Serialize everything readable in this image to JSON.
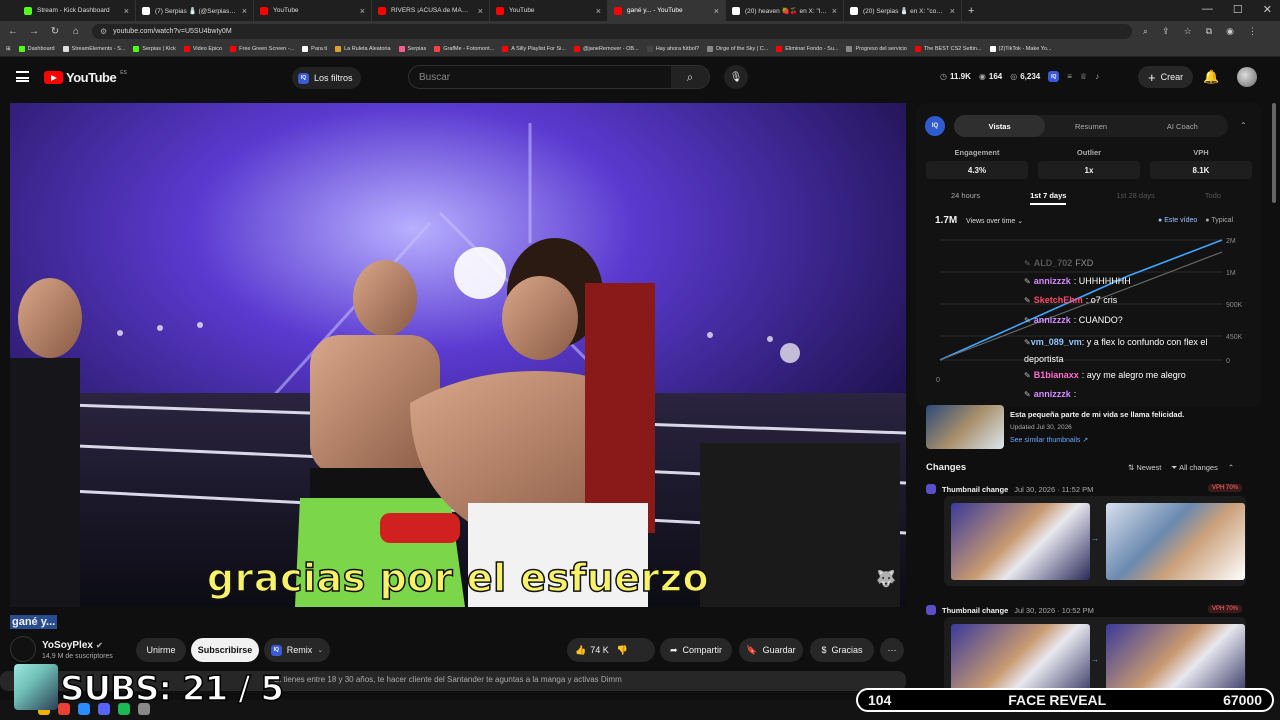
{
  "browser": {
    "tabs": [
      {
        "title": "Stream - Kick Dashboard",
        "color": "#53fc18",
        "active": false
      },
      {
        "title": "(7) Serpias 🧂 (@Serpias) / X",
        "color": "#ffffff",
        "active": false
      },
      {
        "title": "YouTube",
        "color": "#ff0000",
        "active": false
      },
      {
        "title": "RIVERS ¡ACUSA de MANIPULAR",
        "color": "#ff0000",
        "active": false
      },
      {
        "title": "YouTube",
        "color": "#ff0000",
        "active": false
      },
      {
        "title": "gané y... - YouTube",
        "color": "#ff0000",
        "active": true
      },
      {
        "title": "(20) heaven 🍓🍒 en X: \"los lin",
        "color": "#ffffff",
        "active": false
      },
      {
        "title": "(20) Serpias 🧂 en X: \"como las",
        "color": "#ffffff",
        "active": false
      }
    ],
    "new_tab": "+",
    "url": "youtube.com/watch?v=U5SU4bwIy0M",
    "bookmarks": [
      {
        "label": "Dashboard",
        "color": "#53fc18"
      },
      {
        "label": "StreamElements - S...",
        "color": "#dddddd"
      },
      {
        "label": "Serpias | Kick",
        "color": "#53fc18"
      },
      {
        "label": "Video Epico",
        "color": "#ff0000"
      },
      {
        "label": "Free Green Screen -...",
        "color": "#ff0000"
      },
      {
        "label": "Para ti",
        "color": "#ffffff"
      },
      {
        "label": "La Ruleta Aleatoria",
        "color": "#e0a030"
      },
      {
        "label": "Serpias",
        "color": "#ff5a8c"
      },
      {
        "label": "GrafMe - Fotomont...",
        "color": "#ff4040"
      },
      {
        "label": "A Silly Playlist For Si...",
        "color": "#ff0000"
      },
      {
        "label": "@janeRemover - OB...",
        "color": "#ff0000"
      },
      {
        "label": "Hay ahora fútbol?",
        "color": "#444444"
      },
      {
        "label": "Dirge of the Sky | C...",
        "color": "#888888"
      },
      {
        "label": "Eliminar Fondo - Su...",
        "color": "#ff0000"
      },
      {
        "label": "Progreso del servicio",
        "color": "#888888"
      },
      {
        "label": "The BEST CS2 Settin...",
        "color": "#ff0000"
      },
      {
        "label": "(2)TikTok - Make Yo...",
        "color": "#ffffff"
      }
    ]
  },
  "youtube": {
    "logo": "YouTube",
    "country": "ES",
    "filters_label": "Los filtros",
    "search_placeholder": "Buscar",
    "stats": {
      "views": "11.9K",
      "likes": "164",
      "comments": "6,234"
    },
    "create_label": "Crear"
  },
  "video": {
    "subtitle": "gracias por el esfuerzo",
    "title": "gané y...",
    "channel": "YoSoyPlex",
    "subscribers": "14,9 M de suscriptores",
    "join_label": "Unirme",
    "subscribe_label": "Subscribirse",
    "remix_label": "Remix",
    "likes": "74 K",
    "share_label": "Compartir",
    "save_label": "Guardar",
    "thanks_label": "Gracias",
    "description": "Si tienes entre 18 y 30 años, te hacer cliente del Santander te aguntas a la manga y activas Dimm"
  },
  "panel": {
    "iq_label": "IQ",
    "tabs": [
      "Vistas",
      "Resumen",
      "AI Coach"
    ],
    "active_tab": 0,
    "metrics": [
      {
        "label": "Engagement",
        "value": "4.3%"
      },
      {
        "label": "Outlier",
        "value": "1x"
      },
      {
        "label": "VPH",
        "value": "8.1K"
      }
    ],
    "ranges": [
      "24 hours",
      "1st 7 days",
      "1st 28 days",
      "Todo"
    ],
    "active_range": 1,
    "total_views": "1.7M",
    "view_select": "Views over time",
    "legend": [
      "Este vídeo",
      "Typical"
    ],
    "chart_data": {
      "type": "line",
      "title": "",
      "ylabel": "",
      "y_ticks": [
        "2M",
        "1M",
        "900K",
        "450K",
        "0"
      ],
      "x_start_label": "0",
      "series": [
        {
          "name": "Este vídeo",
          "values": [
            0,
            350000,
            700000,
            1050000,
            1400000,
            1700000,
            2000000
          ]
        },
        {
          "name": "Typical",
          "values": [
            0,
            300000,
            600000,
            900000,
            1200000,
            1500000,
            1800000
          ]
        }
      ],
      "ylim": [
        0,
        2000000
      ],
      "colors": {
        "este_video": "#3ea6ff",
        "typical": "#6b6b6b"
      }
    },
    "suggestion": {
      "title": "Esta pequeña parte de mi vida se llama felicidad.",
      "updated": "Updated Jul 30, 2026",
      "link": "See similar thumbnails ↗"
    },
    "changes_title": "Changes",
    "sort_label": "Newest",
    "filter_label": "All changes",
    "changes": [
      {
        "type": "Thumbnail change",
        "date": "Jul 30, 2026 · 11:52 PM",
        "badge": "VPH 70%"
      },
      {
        "type": "Thumbnail change",
        "date": "Jul 30, 2026 · 10:52 PM",
        "badge": "VPH 70%"
      }
    ]
  },
  "chat": [
    {
      "user": "ALD_702",
      "text": "FXD",
      "color": "#9a9a9a"
    },
    {
      "user": "annizzzk",
      "text": ": UHHHHHHH",
      "color": "#d48cff"
    },
    {
      "user": "SketchEhm",
      "text": ": o7 cris",
      "color": "#ff4a6a"
    },
    {
      "user": "annizzzk",
      "text": ": CUANDO?",
      "color": "#d48cff"
    },
    {
      "user": "vm_089_vm",
      "text": ": y a flex lo confundo con flex el deportista",
      "color": "#8fc6ff"
    },
    {
      "user": "B1bianaxx",
      "text": ": ayy me alegro me alegro",
      "color": "#ff6fd0"
    },
    {
      "user": "annizzzk",
      "text": ":",
      "color": "#d48cff"
    }
  ],
  "stream_overlay": {
    "subs": "SUBS: 21 / 5",
    "hud_left": "104",
    "hud_center": "FACE REVEAL",
    "hud_right": "67000"
  }
}
